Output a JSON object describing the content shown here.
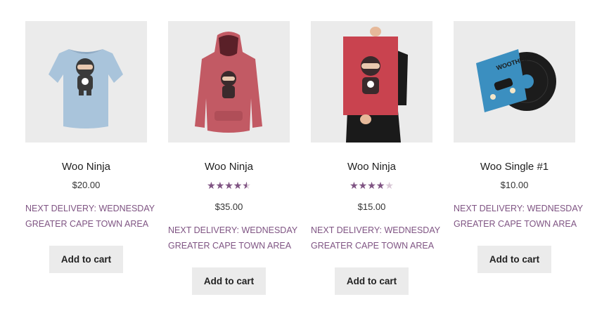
{
  "products": [
    {
      "image": "tshirt-ninja-image",
      "title": "Woo Ninja",
      "rating": null,
      "price": "$20.00",
      "notice_line1": "NEXT DELIVERY: WEDNESDAY",
      "notice_line2": "GREATER CAPE TOWN AREA",
      "button": "Add to cart"
    },
    {
      "image": "hoodie-ninja-image",
      "title": "Woo Ninja",
      "rating": 4.5,
      "price": "$35.00",
      "notice_line1": "NEXT DELIVERY: WEDNESDAY",
      "notice_line2": "GREATER CAPE TOWN AREA",
      "button": "Add to cart"
    },
    {
      "image": "poster-ninja-image",
      "title": "Woo Ninja",
      "rating": 4,
      "price": "$15.00",
      "notice_line1": "NEXT DELIVERY: WEDNESDAY",
      "notice_line2": "GREATER CAPE TOWN AREA",
      "button": "Add to cart"
    },
    {
      "image": "vinyl-record-image",
      "title": "Woo Single #1",
      "rating": null,
      "price": "$10.00",
      "notice_line1": "NEXT DELIVERY: WEDNESDAY",
      "notice_line2": "GREATER CAPE TOWN AREA",
      "button": "Add to cart"
    }
  ],
  "record_sleeve_text": "WOOTHEMES",
  "colors": {
    "accent": "#7f5483",
    "star_empty": "#d9c8d6",
    "thumb_bg": "#ebebeb",
    "button_bg": "#ebebeb"
  }
}
